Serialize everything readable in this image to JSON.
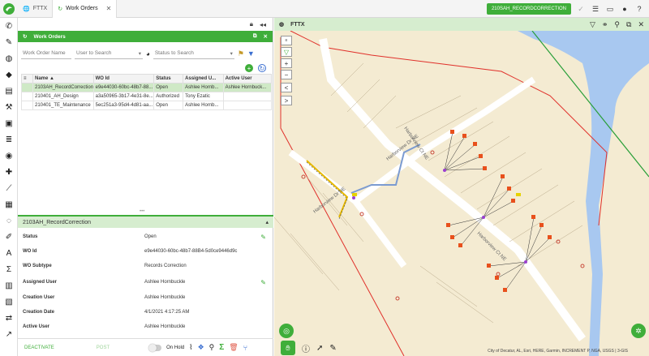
{
  "tabs": [
    {
      "label": "FTTX"
    },
    {
      "label": "Work Orders"
    }
  ],
  "header": {
    "record_button": "210SAH_RECORDCORRECTION"
  },
  "panel": {
    "title": "Work Orders"
  },
  "filters": {
    "work_order_name": "Work Order Name",
    "user_search": "User to Search",
    "status_search": "Status to Search"
  },
  "table": {
    "columns": [
      "Name ▲",
      "WO Id",
      "Status",
      "Assigned U...",
      "Active User"
    ],
    "rows": [
      [
        "2103AH_RecordCorrection",
        "e9e44030-60bc-48b7-88...",
        "Open",
        "Ashlee Hornb...",
        "Ashlee Hornbuck..."
      ],
      [
        "210401_AH_Design",
        "a3a50965-3b17-4e31-8e...",
        "Authorized",
        "Tony Ezatic",
        ""
      ],
      [
        "210401_TE_Maintenance",
        "5ec251a3-95d4-4d81-aa...",
        "Open",
        "Ashlee Hornb...",
        ""
      ]
    ]
  },
  "detail": {
    "title": "2103AH_RecordCorrection",
    "fields": [
      {
        "label": "Status",
        "value": "Open"
      },
      {
        "label": "WO Id",
        "value": "e9e44030-60bc-48b7-88B4-5d0ce9446d9c"
      },
      {
        "label": "WO Subtype",
        "value": "Records Correction"
      },
      {
        "label": "Assigned User",
        "value": "Ashlee Hornbuckle"
      },
      {
        "label": "Creation User",
        "value": "Ashlee Hornbuckle"
      },
      {
        "label": "Creation Date",
        "value": "4/1/2021 4:17:25 AM"
      },
      {
        "label": "Active User",
        "value": "Ashlee Hornbuckle"
      }
    ]
  },
  "footer": {
    "deactivate": "DEACTIVATE",
    "post": "POST",
    "on_hold": "On Hold"
  },
  "map": {
    "title": "FTTX",
    "streets": [
      "Harborview Ct NE",
      "Harborview Dr NE",
      "Harborview Dr NE",
      "Harborview Ct NE"
    ],
    "attribution": "City of Decatur, AL, Esri, HERE, Garmin, INCREMENT P, NGA, USGS | 3-GIS"
  },
  "colors": {
    "accent": "#3fae3a",
    "header_light": "#d6edcf",
    "map_bg": "#f4ebd2",
    "water": "#a8c8f0",
    "boundary": "#e0302a"
  }
}
